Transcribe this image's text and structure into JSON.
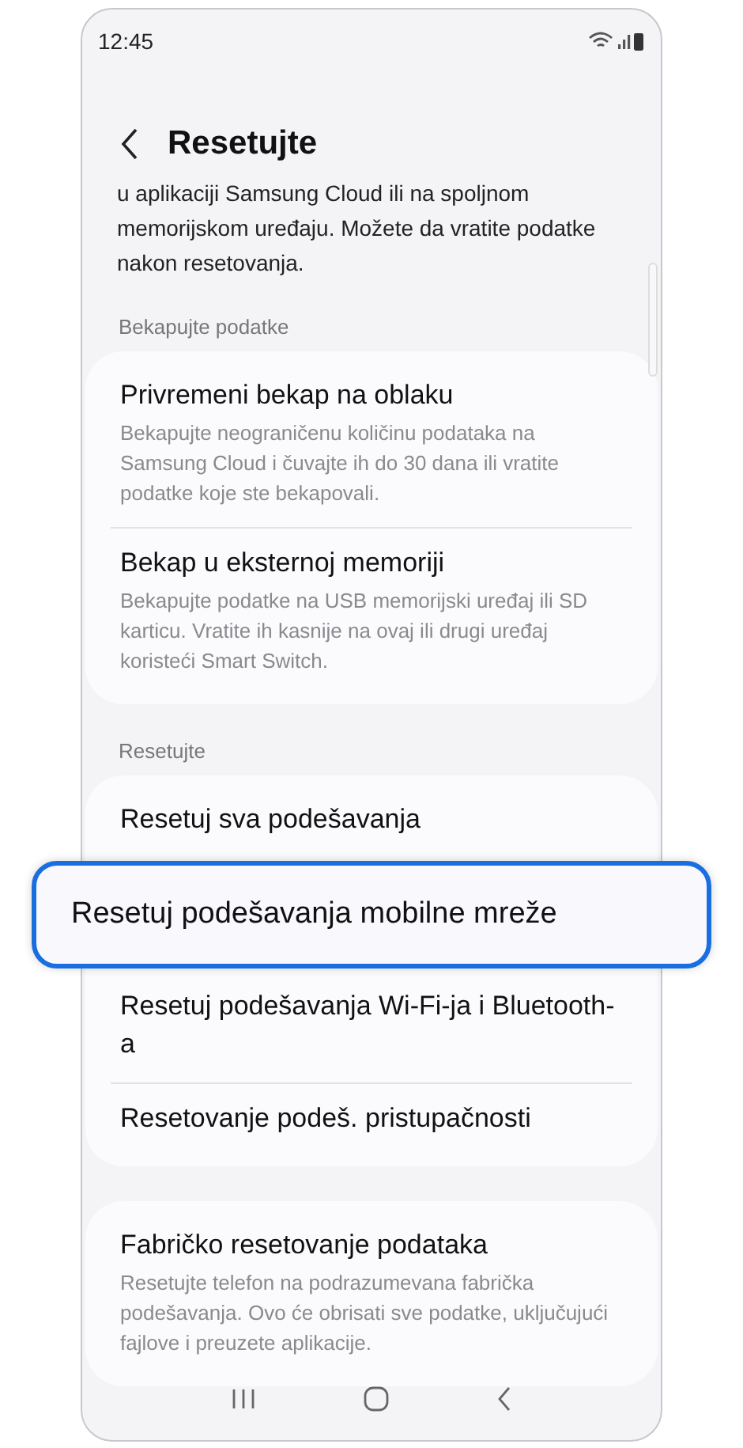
{
  "status_bar": {
    "time": "12:45"
  },
  "header": {
    "title": "Resetujte"
  },
  "intro": "u aplikaciji Samsung Cloud ili na spoljnom memorijskom uređaju. Možete da vratite podatke nakon resetovanja.",
  "sections": [
    {
      "label": "Bekapujte podatke",
      "items": [
        {
          "title": "Privremeni bekap na oblaku",
          "description": "Bekapujte neograničenu količinu podataka na Samsung Cloud i čuvajte ih do 30 dana ili vratite podatke koje ste bekapovali.",
          "highlighted": false
        },
        {
          "title": "Bekap u eksternoj memoriji",
          "description": "Bekapujte podatke na USB memorijski uređaj ili SD karticu. Vratite ih kasnije na ovaj ili drugi uređaj koristeći Smart Switch.",
          "highlighted": false
        }
      ]
    },
    {
      "label": "Resetujte",
      "items": [
        {
          "title": "Resetuj sva podešavanja",
          "highlighted": false
        },
        {
          "title": "Resetuj podešavanja mobilne mreže",
          "highlighted": true
        },
        {
          "title": "Resetuj podešavanja Wi-Fi-ja i Bluetooth-a",
          "highlighted": false
        },
        {
          "title": "Resetovanje podeš. pristupačnosti",
          "highlighted": false
        }
      ]
    },
    {
      "items": [
        {
          "title": "Fabričko resetovanje podataka",
          "description": "Resetujte telefon na podrazumevana fabrička podešavanja. Ovo će obrisati sve podatke, uključujući fajlove i preuzete aplikacije.",
          "highlighted": false
        }
      ]
    }
  ]
}
